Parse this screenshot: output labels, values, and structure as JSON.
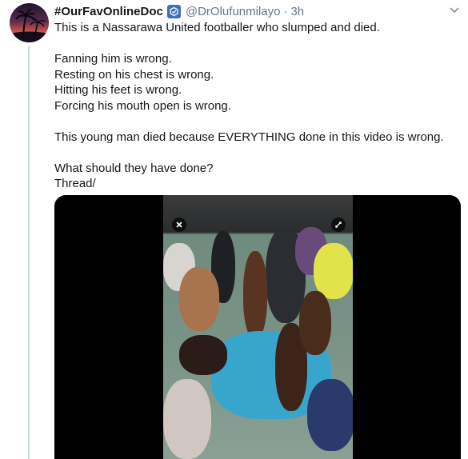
{
  "tweet": {
    "display_name": "#OurFavOnlineDoc",
    "handle": "@DrOlufunmilayo",
    "separator": "·",
    "time": "3h",
    "lines": [
      "This is a Nassarawa United footballer who slumped and died.",
      "",
      "Fanning him is wrong.",
      "Resting on his chest is wrong.",
      "Hitting his feet is wrong.",
      "Forcing his mouth open is wrong.",
      "",
      "This young man died because EVERYTHING done in this video is wrong.",
      "",
      "What should they have done?",
      "Thread/"
    ]
  },
  "icons": {
    "badge": "verified-logo-icon",
    "caret": "chevron-down-icon",
    "close": "close-icon",
    "expand": "expand-icon"
  },
  "colors": {
    "text": "#14171a",
    "muted": "#657786",
    "thread_line": "#ccd6dd",
    "badge": "#3b6fb6"
  }
}
